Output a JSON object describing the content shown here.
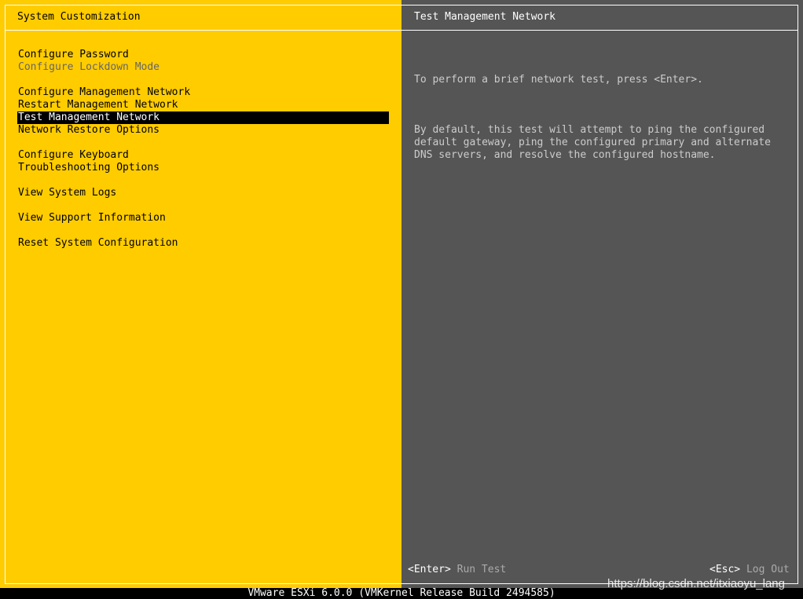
{
  "left_panel": {
    "title": "System Customization",
    "menu": [
      {
        "label": "Configure Password",
        "state": "normal"
      },
      {
        "label": "Configure Lockdown Mode",
        "state": "disabled"
      },
      {
        "gap": true
      },
      {
        "label": "Configure Management Network",
        "state": "normal"
      },
      {
        "label": "Restart Management Network",
        "state": "normal"
      },
      {
        "label": "Test Management Network",
        "state": "selected"
      },
      {
        "label": "Network Restore Options",
        "state": "normal"
      },
      {
        "gap": true
      },
      {
        "label": "Configure Keyboard",
        "state": "normal"
      },
      {
        "label": "Troubleshooting Options",
        "state": "normal"
      },
      {
        "gap": true
      },
      {
        "label": "View System Logs",
        "state": "normal"
      },
      {
        "gap": true
      },
      {
        "label": "View Support Information",
        "state": "normal"
      },
      {
        "gap": true
      },
      {
        "label": "Reset System Configuration",
        "state": "normal"
      }
    ]
  },
  "right_panel": {
    "title": "Test Management Network",
    "paragraphs": [
      "To perform a brief network test, press <Enter>.",
      "By default, this test will attempt to ping the configured\ndefault gateway, ping the configured primary and alternate\nDNS servers, and resolve the configured hostname."
    ],
    "footer_left": {
      "key": "<Enter>",
      "action": "Run Test"
    },
    "footer_right": {
      "key": "<Esc>",
      "action": "Log Out"
    }
  },
  "status_bar": {
    "text": "VMware ESXi 6.0.0 (VMKernel Release Build 2494585)"
  },
  "watermark": {
    "text": "https://blog.csdn.net/itxiaoyu_lang"
  },
  "colors": {
    "left_background": "#ffcc00",
    "right_background": "#555555",
    "selected_background": "#000000",
    "selected_text": "#ffffff",
    "disabled_text": "#666666"
  }
}
